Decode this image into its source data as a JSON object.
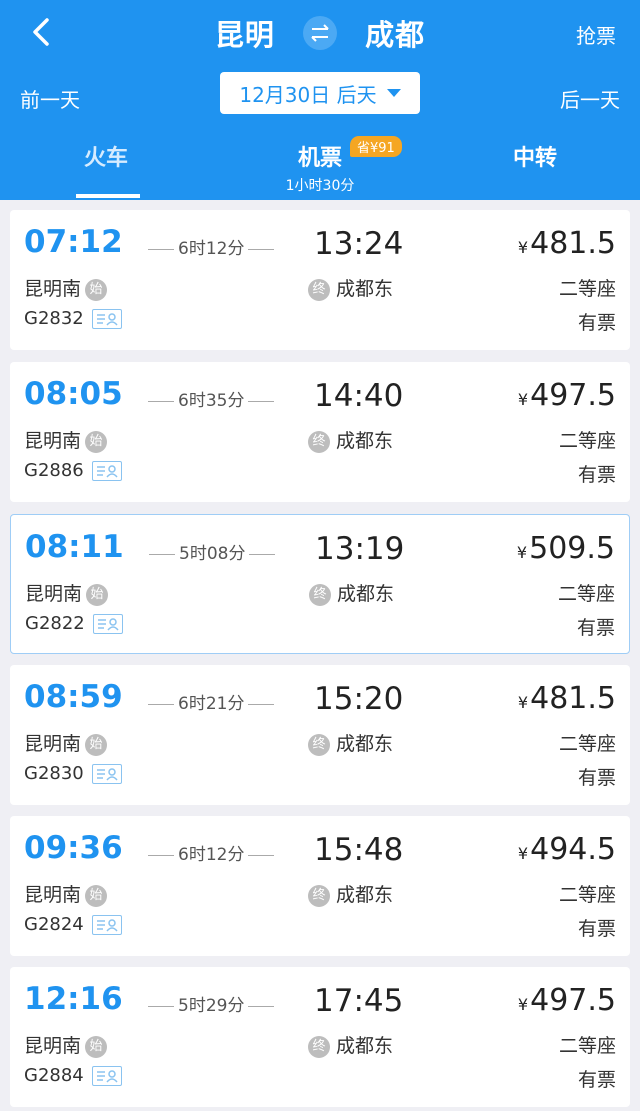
{
  "header": {
    "from_city": "昆明",
    "to_city": "成都",
    "grab_label": "抢票",
    "prev_day": "前一天",
    "next_day": "后一天",
    "date_label": "12月30日 后天",
    "tabs": {
      "train": "火车",
      "flight": "机票",
      "flight_sub": "1小时30分",
      "flight_badge": "省¥91",
      "transfer": "中转"
    }
  },
  "colors": {
    "primary": "#1f93f0",
    "badge": "#f5a623"
  },
  "icons": [
    "back-icon",
    "swap-icon",
    "dropdown-caret-icon",
    "start-station-icon",
    "end-station-icon",
    "id-card-icon"
  ],
  "trains": [
    {
      "dep": "07:12",
      "duration": "6时12分",
      "arr": "13:24",
      "price": "481.5",
      "from": "昆明南",
      "from_mark": "始",
      "to": "成都东",
      "to_mark": "终",
      "seat": "二等座",
      "no": "G2832",
      "avail": "有票"
    },
    {
      "dep": "08:05",
      "duration": "6时35分",
      "arr": "14:40",
      "price": "497.5",
      "from": "昆明南",
      "from_mark": "始",
      "to": "成都东",
      "to_mark": "终",
      "seat": "二等座",
      "no": "G2886",
      "avail": "有票"
    },
    {
      "dep": "08:11",
      "duration": "5时08分",
      "arr": "13:19",
      "price": "509.5",
      "from": "昆明南",
      "from_mark": "始",
      "to": "成都东",
      "to_mark": "终",
      "seat": "二等座",
      "no": "G2822",
      "avail": "有票"
    },
    {
      "dep": "08:59",
      "duration": "6时21分",
      "arr": "15:20",
      "price": "481.5",
      "from": "昆明南",
      "from_mark": "始",
      "to": "成都东",
      "to_mark": "终",
      "seat": "二等座",
      "no": "G2830",
      "avail": "有票"
    },
    {
      "dep": "09:36",
      "duration": "6时12分",
      "arr": "15:48",
      "price": "494.5",
      "from": "昆明南",
      "from_mark": "始",
      "to": "成都东",
      "to_mark": "终",
      "seat": "二等座",
      "no": "G2824",
      "avail": "有票"
    },
    {
      "dep": "12:16",
      "duration": "5时29分",
      "arr": "17:45",
      "price": "497.5",
      "from": "昆明南",
      "from_mark": "始",
      "to": "成都东",
      "to_mark": "终",
      "seat": "二等座",
      "no": "G2884",
      "avail": "有票"
    }
  ],
  "currency_symbol": "¥"
}
